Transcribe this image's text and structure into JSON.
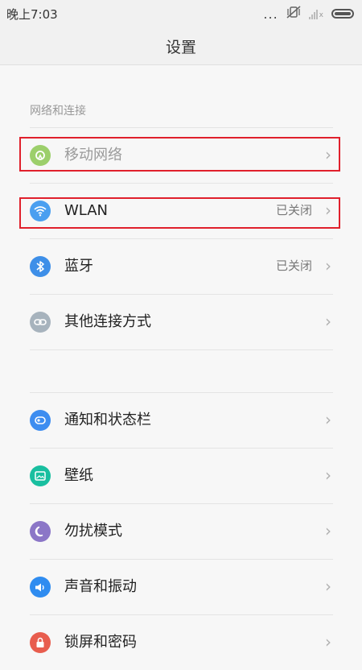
{
  "status_bar": {
    "time": "晚上7:03",
    "dots": "...",
    "icons": [
      "vibrate-off-icon",
      "signal-icon",
      "battery-icon"
    ]
  },
  "title": "设置",
  "section_label": "网络和连接",
  "colors": {
    "mobile_network": "#8bc34a",
    "wlan": "#4a9ff0",
    "bluetooth": "#3e8fe8",
    "other_connect": "#a7b3bd",
    "notifications": "#3d8df0",
    "wallpaper": "#19bfa0",
    "dnd": "#8b76c7",
    "sound": "#2f8cf0",
    "lock": "#e85d4e",
    "highlight": "#e0202c"
  },
  "rows": {
    "mobile_network": {
      "label": "移动网络",
      "chevron": "›"
    },
    "wlan": {
      "label": "WLAN",
      "value": "已关闭",
      "chevron": "›"
    },
    "bluetooth": {
      "label": "蓝牙",
      "value": "已关闭",
      "chevron": "›"
    },
    "other_connect": {
      "label": "其他连接方式",
      "chevron": "›"
    },
    "notifications": {
      "label": "通知和状态栏",
      "chevron": "›"
    },
    "wallpaper": {
      "label": "壁纸",
      "chevron": "›"
    },
    "dnd": {
      "label": "勿扰模式",
      "chevron": "›"
    },
    "sound": {
      "label": "声音和振动",
      "chevron": "›"
    },
    "lock": {
      "label": "锁屏和密码",
      "chevron": "›"
    }
  }
}
